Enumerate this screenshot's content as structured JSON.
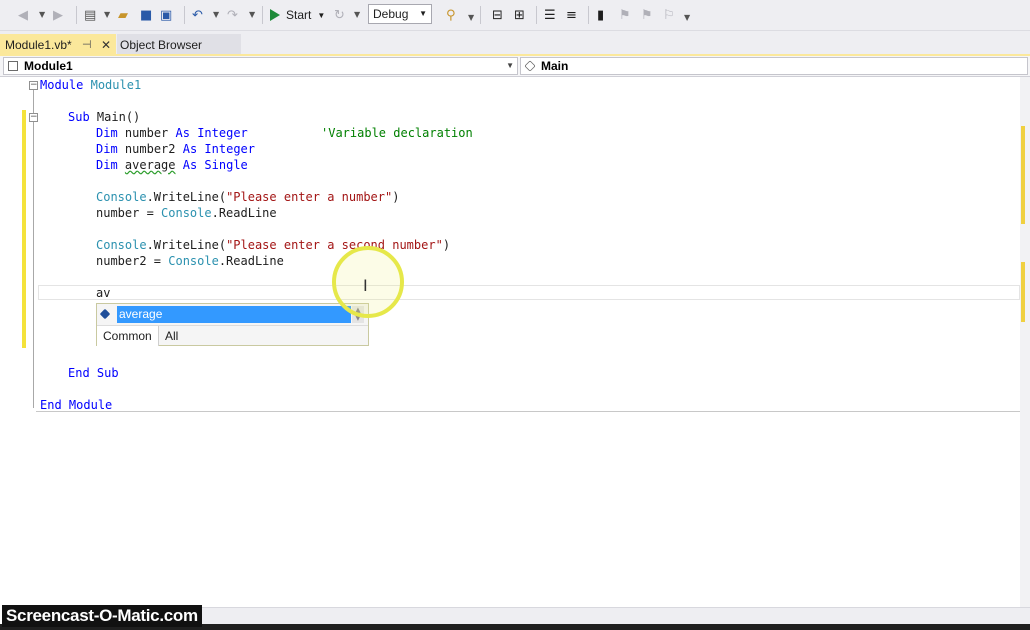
{
  "toolbar": {
    "start_label": "Start",
    "configuration": "Debug"
  },
  "tabs": [
    {
      "label": "Module1.vb*",
      "pin": "⊣",
      "close": "✕"
    },
    {
      "label": "Object Browser"
    }
  ],
  "navbar": {
    "left": "Module1",
    "right": "Main"
  },
  "code": {
    "lines": [
      {
        "kw": "Module",
        "ty": "Module1"
      },
      {
        "sub": "Sub",
        "name": "Main()"
      },
      {
        "kw1": "Dim",
        "var": "number",
        "kw2": "As",
        "kw3": "Integer",
        "comment": "'Variable declaration"
      },
      {
        "kw1": "Dim",
        "var": "number2",
        "kw2": "As",
        "kw3": "Integer"
      },
      {
        "kw1": "Dim",
        "var": "average",
        "kw2": "As",
        "kw3": "Single"
      },
      {
        "obj": "Console",
        "method": ".WriteLine(",
        "str": "\"Please enter a number\"",
        "end": ")"
      },
      {
        "var": "number = ",
        "obj": "Console",
        "method": ".ReadLine"
      },
      {
        "obj": "Console",
        "method": ".WriteLine(",
        "str": "\"Please enter a second number\"",
        "end": ")"
      },
      {
        "var": "number2 = ",
        "obj": "Console",
        "method": ".ReadLine"
      },
      {
        "text": "av"
      },
      {
        "kw1": "End",
        "kw2": "Sub"
      },
      {
        "kw1": "End",
        "kw2": "Module"
      }
    ]
  },
  "intellisense": {
    "item": "average",
    "tab_common": "Common",
    "tab_all": "All"
  },
  "watermark": "Screencast-O-Matic.com",
  "colors": {
    "keyword": "#0000ff",
    "type": "#2b91af",
    "string": "#a31515",
    "comment": "#008000",
    "active_tab": "#fbe89b",
    "selection": "#3399ff"
  }
}
